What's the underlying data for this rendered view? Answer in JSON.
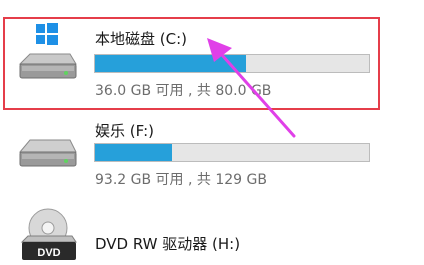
{
  "colors": {
    "usage_bar": "#26a0da",
    "highlight": "#e53d4a",
    "arrow": "#e040e8"
  },
  "drives": [
    {
      "name": "本地磁盘 (C:)",
      "info": "36.0 GB 可用 , 共 80.0 GB",
      "used_fraction": 0.55,
      "icon": "windows-system-drive-icon"
    },
    {
      "name": "娱乐 (F:)",
      "info": "93.2 GB 可用 , 共 129 GB",
      "used_fraction": 0.28,
      "icon": "hard-drive-icon"
    },
    {
      "name": "DVD RW 驱动器 (H:)",
      "icon": "dvd-drive-icon",
      "dvd_label": "DVD"
    }
  ]
}
